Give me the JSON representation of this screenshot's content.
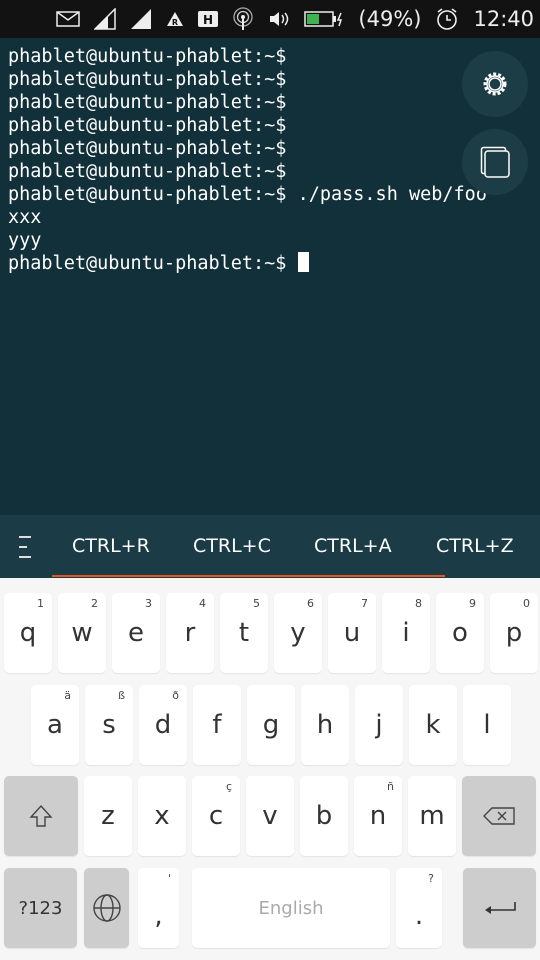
{
  "status_bar": {
    "icons": [
      "mail-icon",
      "signal-icon",
      "signal-full-icon",
      "roaming-icon",
      "hspa-icon",
      "hotspot-icon",
      "volume-icon",
      "battery-charging-icon",
      "alarm-icon"
    ],
    "battery": "(49%)",
    "time": "12:40",
    "battery_color": "#3eb34f"
  },
  "terminal": {
    "lines": [
      "phablet@ubuntu-phablet:~$",
      "phablet@ubuntu-phablet:~$",
      "phablet@ubuntu-phablet:~$",
      "phablet@ubuntu-phablet:~$",
      "phablet@ubuntu-phablet:~$",
      "phablet@ubuntu-phablet:~$",
      "phablet@ubuntu-phablet:~$ ./pass.sh web/foo",
      "xxx",
      "yyy"
    ],
    "prompt": "phablet@ubuntu-phablet:~$ ",
    "background": "#11303a"
  },
  "buttons": {
    "settings": "gear-icon",
    "tabs": "copy-icon"
  },
  "shortcuts": {
    "menu_icon": "menu-icon",
    "items": [
      "CTRL+R",
      "CTRL+C",
      "CTRL+A",
      "CTRL+Z"
    ],
    "accent": "#e95420"
  },
  "keyboard": {
    "row1": [
      {
        "k": "q",
        "a": "1"
      },
      {
        "k": "w",
        "a": "2"
      },
      {
        "k": "e",
        "a": "3"
      },
      {
        "k": "r",
        "a": "4"
      },
      {
        "k": "t",
        "a": "5"
      },
      {
        "k": "y",
        "a": "6"
      },
      {
        "k": "u",
        "a": "7"
      },
      {
        "k": "i",
        "a": "8"
      },
      {
        "k": "o",
        "a": "9"
      },
      {
        "k": "p",
        "a": "0"
      }
    ],
    "row2": [
      {
        "k": "a",
        "a": "ä"
      },
      {
        "k": "s",
        "a": "ß"
      },
      {
        "k": "d",
        "a": "ð"
      },
      {
        "k": "f",
        "a": ""
      },
      {
        "k": "g",
        "a": ""
      },
      {
        "k": "h",
        "a": ""
      },
      {
        "k": "j",
        "a": ""
      },
      {
        "k": "k",
        "a": ""
      },
      {
        "k": "l",
        "a": ""
      }
    ],
    "row3": [
      {
        "k": "z",
        "a": ""
      },
      {
        "k": "x",
        "a": ""
      },
      {
        "k": "c",
        "a": "ç"
      },
      {
        "k": "v",
        "a": ""
      },
      {
        "k": "b",
        "a": ""
      },
      {
        "k": "n",
        "a": "ñ"
      },
      {
        "k": "m",
        "a": ""
      }
    ],
    "symbols": "?123",
    "comma": ",",
    "comma_alt": "'",
    "space": "English",
    "period": ".",
    "period_alt": "?"
  }
}
